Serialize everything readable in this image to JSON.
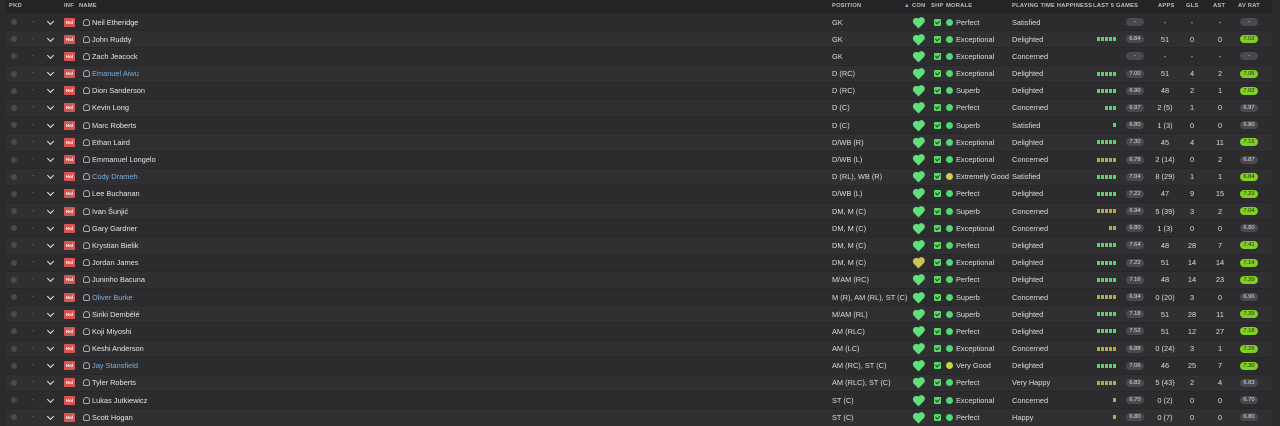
{
  "headers": {
    "pkd": "PKD",
    "inf": "INF",
    "name": "NAME",
    "position": "POSITION",
    "con": "CON",
    "shp": "SHP",
    "morale": "MORALE",
    "playing_time": "PLAYING TIME HAPPINESS",
    "last5": "LAST 5 GAMES",
    "apps": "APPS",
    "gls": "GLS",
    "ast": "AST",
    "avrat": "AV RAT"
  },
  "status_label": "Hol",
  "icons": {
    "condition": "heart-icon",
    "sharpness": "check-icon",
    "morale": "morale-dot-icon",
    "row_menu": "chevron-down-icon"
  },
  "colors": {
    "accent_green": "#7fcf26",
    "injury_red": "#d9534f",
    "highlight_name": "#7aaedb"
  },
  "players": [
    {
      "name": "Neil Etheridge",
      "position": "GK",
      "morale": "Perfect",
      "playing_time": "Satisfied",
      "last5": [],
      "last5_rating": "-",
      "apps": "-",
      "gls": "-",
      "ast": "-",
      "avrat": "-",
      "rating_hi": false,
      "name_hi": false,
      "con_low": false,
      "morale_low": false
    },
    {
      "name": "John Ruddy",
      "position": "GK",
      "morale": "Exceptional",
      "playing_time": "Delighted",
      "last5": [
        "g",
        "g",
        "g",
        "g",
        "g"
      ],
      "last5_rating": "6.84",
      "apps": "51",
      "gls": "0",
      "ast": "0",
      "avrat": "7.02",
      "rating_hi": true,
      "name_hi": false,
      "con_low": false,
      "morale_low": false
    },
    {
      "name": "Zach Jeacock",
      "position": "GK",
      "morale": "Exceptional",
      "playing_time": "Concerned",
      "last5": [],
      "last5_rating": "-",
      "apps": "-",
      "gls": "-",
      "ast": "-",
      "avrat": "-",
      "rating_hi": false,
      "name_hi": false,
      "con_low": false,
      "morale_low": false
    },
    {
      "name": "Emanuel Aiwu",
      "position": "D (RC)",
      "morale": "Exceptional",
      "playing_time": "Delighted",
      "last5": [
        "g",
        "g",
        "g",
        "g",
        "g"
      ],
      "last5_rating": "7.00",
      "apps": "51",
      "gls": "4",
      "ast": "2",
      "avrat": "7.06",
      "rating_hi": true,
      "name_hi": true,
      "con_low": false,
      "morale_low": false
    },
    {
      "name": "Dion Sanderson",
      "position": "D (RC)",
      "morale": "Superb",
      "playing_time": "Delighted",
      "last5": [
        "g",
        "g",
        "g",
        "g",
        "g"
      ],
      "last5_rating": "6.90",
      "apps": "48",
      "gls": "2",
      "ast": "1",
      "avrat": "7.02",
      "rating_hi": true,
      "name_hi": false,
      "con_low": false,
      "morale_low": false
    },
    {
      "name": "Kevin Long",
      "position": "D (C)",
      "morale": "Perfect",
      "playing_time": "Concerned",
      "last5": [
        "g",
        "g",
        "g"
      ],
      "last5_rating": "6.97",
      "apps": "2 (5)",
      "gls": "1",
      "ast": "0",
      "avrat": "6.97",
      "rating_hi": false,
      "name_hi": false,
      "con_low": false,
      "morale_low": false
    },
    {
      "name": "Marc Roberts",
      "position": "D (C)",
      "morale": "Superb",
      "playing_time": "Satisfied",
      "last5": [
        "g"
      ],
      "last5_rating": "6.80",
      "apps": "1 (3)",
      "gls": "0",
      "ast": "0",
      "avrat": "6.80",
      "rating_hi": false,
      "name_hi": false,
      "con_low": false,
      "morale_low": false
    },
    {
      "name": "Ethan Laird",
      "position": "D/WB (R)",
      "morale": "Exceptional",
      "playing_time": "Delighted",
      "last5": [
        "g",
        "g",
        "g",
        "g",
        "g"
      ],
      "last5_rating": "7.30",
      "apps": "45",
      "gls": "4",
      "ast": "11",
      "avrat": "7.15",
      "rating_hi": true,
      "name_hi": false,
      "con_low": false,
      "morale_low": false
    },
    {
      "name": "Emmanuel Longelo",
      "position": "D/WB (L)",
      "morale": "Exceptional",
      "playing_time": "Concerned",
      "last5": [
        "o",
        "o",
        "o",
        "o",
        "o"
      ],
      "last5_rating": "6.78",
      "apps": "2 (14)",
      "gls": "0",
      "ast": "2",
      "avrat": "6.87",
      "rating_hi": false,
      "name_hi": false,
      "con_low": false,
      "morale_low": false
    },
    {
      "name": "Cody Drameh",
      "position": "D (RL), WB (R)",
      "morale": "Extremely Good",
      "playing_time": "Satisfied",
      "last5": [
        "g",
        "g",
        "g",
        "g",
        "g"
      ],
      "last5_rating": "7.04",
      "apps": "8 (29)",
      "gls": "1",
      "ast": "1",
      "avrat": "6.84",
      "rating_hi": true,
      "name_hi": true,
      "con_low": false,
      "morale_low": true
    },
    {
      "name": "Lee Buchanan",
      "position": "D/WB (L)",
      "morale": "Perfect",
      "playing_time": "Delighted",
      "last5": [
        "g",
        "g",
        "g",
        "g",
        "g"
      ],
      "last5_rating": "7.22",
      "apps": "47",
      "gls": "9",
      "ast": "15",
      "avrat": "7.23",
      "rating_hi": true,
      "name_hi": false,
      "con_low": false,
      "morale_low": false
    },
    {
      "name": "Ivan Šunjić",
      "position": "DM, M (C)",
      "morale": "Superb",
      "playing_time": "Concerned",
      "last5": [
        "o",
        "o",
        "o",
        "o",
        "o"
      ],
      "last5_rating": "6.94",
      "apps": "5 (39)",
      "gls": "3",
      "ast": "2",
      "avrat": "7.04",
      "rating_hi": true,
      "name_hi": false,
      "con_low": false,
      "morale_low": false
    },
    {
      "name": "Gary Gardner",
      "position": "DM, M (C)",
      "morale": "Exceptional",
      "playing_time": "Concerned",
      "last5": [
        "o",
        "o"
      ],
      "last5_rating": "6.80",
      "apps": "1 (3)",
      "gls": "0",
      "ast": "0",
      "avrat": "6.80",
      "rating_hi": false,
      "name_hi": false,
      "con_low": false,
      "morale_low": false
    },
    {
      "name": "Krystian Bielik",
      "position": "DM, M (C)",
      "morale": "Perfect",
      "playing_time": "Delighted",
      "last5": [
        "g",
        "g",
        "g",
        "g",
        "g"
      ],
      "last5_rating": "7.64",
      "apps": "48",
      "gls": "28",
      "ast": "7",
      "avrat": "7.41",
      "rating_hi": true,
      "name_hi": false,
      "con_low": false,
      "morale_low": false
    },
    {
      "name": "Jordan James",
      "position": "DM, M (C)",
      "morale": "Exceptional",
      "playing_time": "Delighted",
      "last5": [
        "g",
        "g",
        "g",
        "g",
        "g"
      ],
      "last5_rating": "7.22",
      "apps": "51",
      "gls": "14",
      "ast": "14",
      "avrat": "7.14",
      "rating_hi": true,
      "name_hi": false,
      "con_low": true,
      "morale_low": false
    },
    {
      "name": "Juninho Bacuna",
      "position": "M/AM (RC)",
      "morale": "Perfect",
      "playing_time": "Delighted",
      "last5": [
        "g",
        "g",
        "g",
        "g",
        "g"
      ],
      "last5_rating": "7.16",
      "apps": "48",
      "gls": "14",
      "ast": "23",
      "avrat": "7.39",
      "rating_hi": true,
      "name_hi": false,
      "con_low": false,
      "morale_low": false
    },
    {
      "name": "Oliver Burke",
      "position": "M (R), AM (RL), ST (C)",
      "morale": "Superb",
      "playing_time": "Concerned",
      "last5": [
        "o",
        "o",
        "o",
        "o",
        "o"
      ],
      "last5_rating": "6.94",
      "apps": "0 (20)",
      "gls": "3",
      "ast": "0",
      "avrat": "6.96",
      "rating_hi": false,
      "name_hi": true,
      "con_low": false,
      "morale_low": false
    },
    {
      "name": "Siriki Dembélé",
      "position": "M/AM (RL)",
      "morale": "Superb",
      "playing_time": "Delighted",
      "last5": [
        "g",
        "g",
        "g",
        "g",
        "g"
      ],
      "last5_rating": "7.18",
      "apps": "51",
      "gls": "28",
      "ast": "11",
      "avrat": "7.39",
      "rating_hi": true,
      "name_hi": false,
      "con_low": false,
      "morale_low": false
    },
    {
      "name": "Koji Miyoshi",
      "position": "AM (RLC)",
      "morale": "Perfect",
      "playing_time": "Delighted",
      "last5": [
        "g",
        "g",
        "g",
        "g",
        "g"
      ],
      "last5_rating": "7.52",
      "apps": "51",
      "gls": "12",
      "ast": "27",
      "avrat": "7.18",
      "rating_hi": true,
      "name_hi": false,
      "con_low": false,
      "morale_low": false
    },
    {
      "name": "Keshi Anderson",
      "position": "AM (LC)",
      "morale": "Exceptional",
      "playing_time": "Concerned",
      "last5": [
        "o",
        "o",
        "o",
        "o",
        "o"
      ],
      "last5_rating": "6.88",
      "apps": "0 (24)",
      "gls": "3",
      "ast": "1",
      "avrat": "7.26",
      "rating_hi": true,
      "name_hi": false,
      "con_low": false,
      "morale_low": false
    },
    {
      "name": "Jay Stansfield",
      "position": "AM (RC), ST (C)",
      "morale": "Very Good",
      "playing_time": "Delighted",
      "last5": [
        "g",
        "g",
        "g",
        "g",
        "g"
      ],
      "last5_rating": "7.06",
      "apps": "46",
      "gls": "25",
      "ast": "7",
      "avrat": "7.30",
      "rating_hi": true,
      "name_hi": true,
      "con_low": false,
      "morale_low": true
    },
    {
      "name": "Tyler Roberts",
      "position": "AM (RLC), ST (C)",
      "morale": "Perfect",
      "playing_time": "Very Happy",
      "last5": [
        "o",
        "o",
        "o",
        "o",
        "o"
      ],
      "last5_rating": "6.82",
      "apps": "5 (43)",
      "gls": "2",
      "ast": "4",
      "avrat": "6.83",
      "rating_hi": false,
      "name_hi": false,
      "con_low": false,
      "morale_low": false
    },
    {
      "name": "Lukas Jutkiewicz",
      "position": "ST (C)",
      "morale": "Exceptional",
      "playing_time": "Concerned",
      "last5": [
        "o"
      ],
      "last5_rating": "6.70",
      "apps": "0 (2)",
      "gls": "0",
      "ast": "0",
      "avrat": "6.70",
      "rating_hi": false,
      "name_hi": false,
      "con_low": false,
      "morale_low": false
    },
    {
      "name": "Scott Hogan",
      "position": "ST (C)",
      "morale": "Perfect",
      "playing_time": "Happy",
      "last5": [
        "o"
      ],
      "last5_rating": "6.80",
      "apps": "0 (7)",
      "gls": "0",
      "ast": "0",
      "avrat": "6.80",
      "rating_hi": false,
      "name_hi": false,
      "con_low": false,
      "morale_low": false
    }
  ]
}
